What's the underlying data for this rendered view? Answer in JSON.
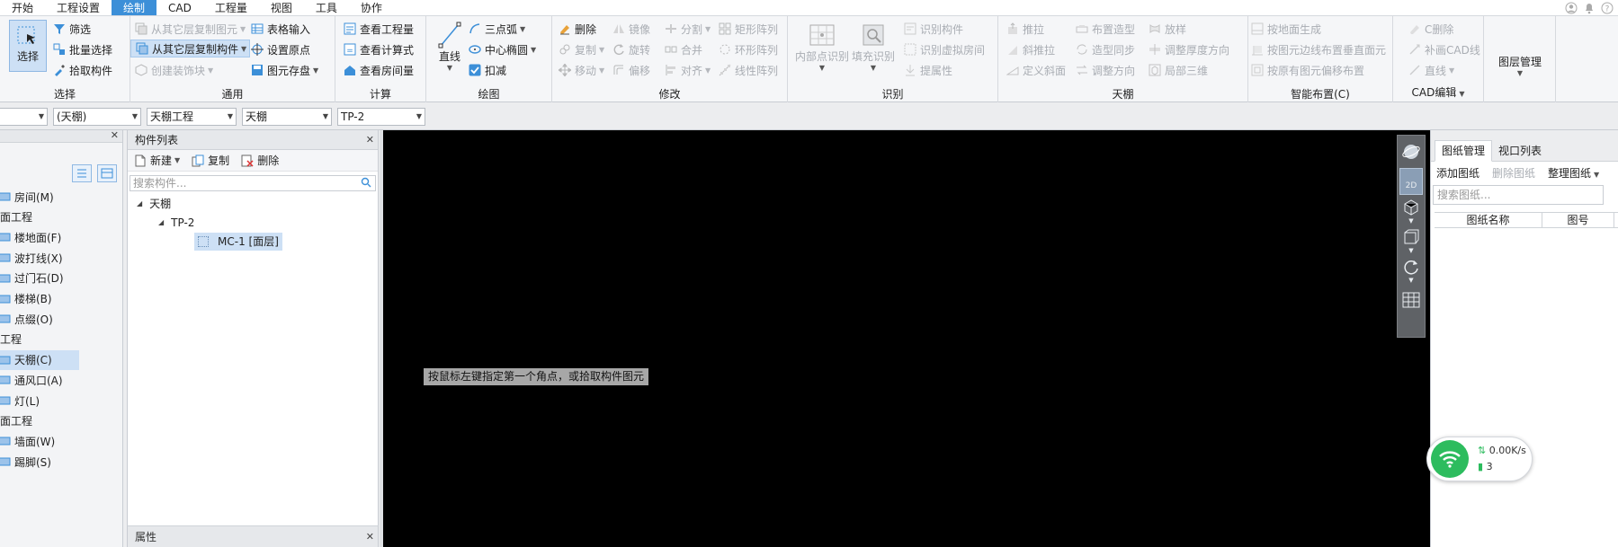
{
  "menubar": {
    "tabs": [
      "开始",
      "工程设置",
      "绘制",
      "CAD",
      "工程量",
      "视图",
      "工具",
      "协作"
    ],
    "active_index": 2
  },
  "ribbon": {
    "select": {
      "label": "选择",
      "group_label": "选择"
    },
    "select_small": [
      "筛选",
      "批量选择",
      "拾取构件"
    ],
    "common": {
      "items": [
        "从其它层复制图元",
        "从其它层复制构件",
        "创建装饰块"
      ],
      "items2": [
        "表格输入",
        "设置原点",
        "图元存盘"
      ],
      "group_label": "通用"
    },
    "calc": {
      "items": [
        "查看工程量",
        "查看计算式",
        "查看房间量"
      ],
      "group_label": "计算"
    },
    "draw": {
      "big": "直线",
      "items": [
        "三点弧",
        "中心椭圆",
        "扣减"
      ],
      "group_label": "绘图"
    },
    "modify": {
      "col1": [
        "删除",
        "复制",
        "移动"
      ],
      "col2": [
        "镜像",
        "旋转",
        "偏移"
      ],
      "col3": [
        "分割",
        "合并",
        "对齐"
      ],
      "col4": [
        "矩形阵列",
        "环形阵列",
        "线性阵列"
      ],
      "group_label": "修改"
    },
    "identify": {
      "big1": "内部点识别",
      "big2": "填充识别",
      "items": [
        "识别构件",
        "识别虚拟房间",
        "提属性"
      ],
      "group_label": "识别"
    },
    "ceiling": {
      "col1": [
        "推拉",
        "斜推拉",
        "定义斜面"
      ],
      "col2": [
        "布置造型",
        "造型同步",
        "调整方向"
      ],
      "col3": [
        "放样",
        "调整厚度方向",
        "局部三维"
      ],
      "group_label": "天棚"
    },
    "smart": {
      "items": [
        "按地面生成",
        "按图元边线布置垂直面元",
        "按原有图元偏移布置"
      ],
      "group_label": "智能布置(C)"
    },
    "cad": {
      "items": [
        "C删除",
        "补画CAD线",
        "直线"
      ],
      "group_label": "CAD编辑"
    },
    "layer": {
      "label": "图层管理"
    }
  },
  "toolbar": {
    "combos": [
      "",
      "(天棚)",
      "天棚工程",
      "天棚",
      "TP-2"
    ]
  },
  "nav": {
    "items": [
      {
        "label": "房间(M)",
        "type": "item"
      },
      {
        "label": "面工程",
        "type": "header"
      },
      {
        "label": "楼地面(F)",
        "type": "item"
      },
      {
        "label": "波打线(X)",
        "type": "item"
      },
      {
        "label": "过门石(D)",
        "type": "item"
      },
      {
        "label": "楼梯(B)",
        "type": "item"
      },
      {
        "label": "点缀(O)",
        "type": "item"
      },
      {
        "label": "工程",
        "type": "header"
      },
      {
        "label": "天棚(C)",
        "type": "item",
        "selected": true
      },
      {
        "label": "通风口(A)",
        "type": "item"
      },
      {
        "label": "灯(L)",
        "type": "item"
      },
      {
        "label": "面工程",
        "type": "header"
      },
      {
        "label": "墙面(W)",
        "type": "item"
      },
      {
        "label": "踢脚(S)",
        "type": "item"
      }
    ]
  },
  "complist": {
    "title": "构件列表",
    "new_label": "新建",
    "copy_label": "复制",
    "delete_label": "删除",
    "search_placeholder": "搜索构件...",
    "tree": [
      "天棚",
      "TP-2",
      "MC-1 [面层]"
    ]
  },
  "props": {
    "title": "属性"
  },
  "canvas": {
    "hint": "按鼠标左键指定第一个角点，或拾取构件图元"
  },
  "viewtools": {
    "label_2d": "2D"
  },
  "rightpanel": {
    "tabs": [
      "图纸管理",
      "视口列表"
    ],
    "add_label": "添加图纸",
    "delete_label": "删除图纸",
    "organize_label": "整理图纸",
    "search_placeholder": "搜索图纸...",
    "columns": [
      "图纸名称",
      "图号"
    ]
  },
  "network": {
    "speed": "0.00K/s",
    "count": "3"
  },
  "colors": {
    "accent": "#3c8fd8",
    "canvas": "#000000",
    "wifi": "#2dbc5e"
  }
}
